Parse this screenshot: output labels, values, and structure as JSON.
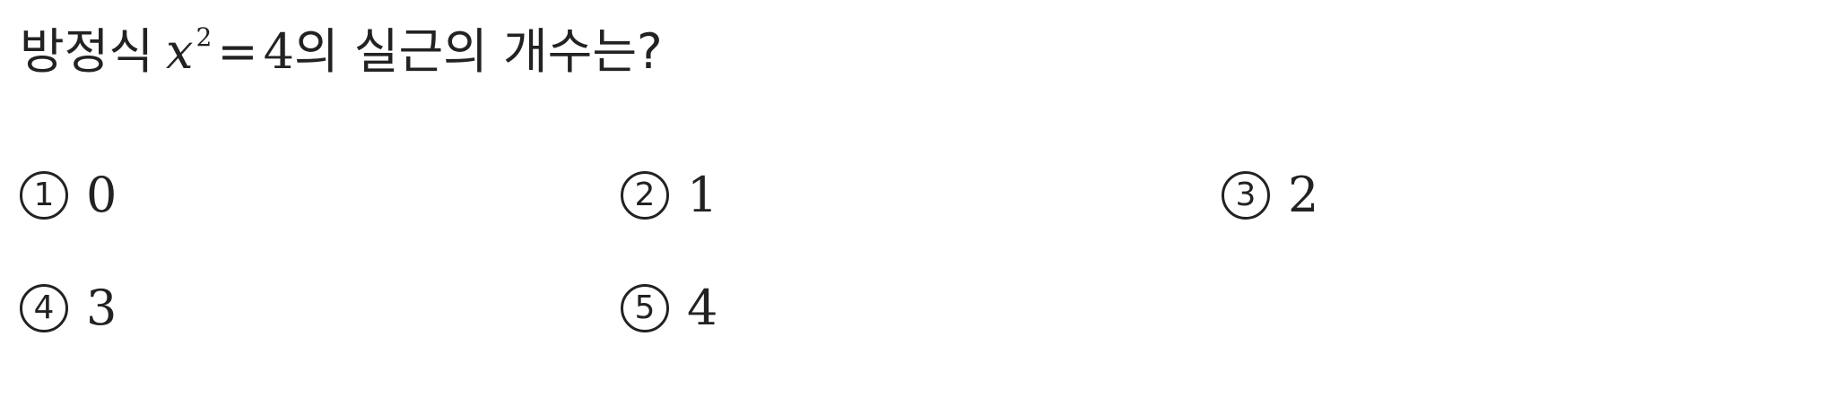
{
  "question": {
    "prefix": "방정식",
    "variable": "x",
    "exponent": "2",
    "equals": "=",
    "constant": "4",
    "suffix": "의 실근의 개수는?"
  },
  "choices": [
    {
      "number": "1",
      "value": "0"
    },
    {
      "number": "2",
      "value": "1"
    },
    {
      "number": "3",
      "value": "2"
    },
    {
      "number": "4",
      "value": "3"
    },
    {
      "number": "5",
      "value": "4"
    }
  ]
}
